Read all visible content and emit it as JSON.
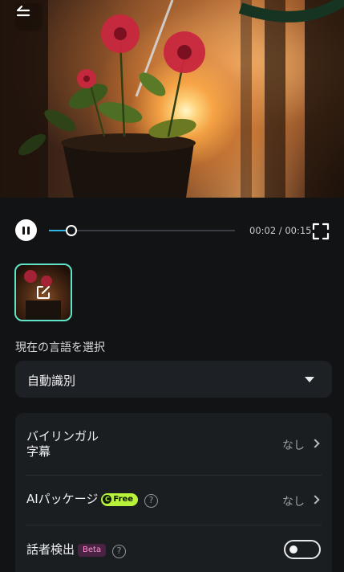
{
  "player": {
    "time_display": "00:02 / 00:15",
    "progress_fraction": 0.12
  },
  "language": {
    "label": "現在の言語を選択",
    "selected": "自動識別"
  },
  "settings": {
    "bilingual": {
      "title": "バイリンガル\n字幕",
      "value": "なし"
    },
    "ai_package": {
      "title": "AIパッケージ",
      "badge": "Free",
      "badge_coin": "C",
      "value": "なし",
      "help": "?"
    },
    "speaker": {
      "title": "話者検出",
      "badge": "Beta",
      "help": "?",
      "enabled": false
    }
  },
  "colors": {
    "accent_teal": "#5fe3c9",
    "progress_blue": "#31b4e6",
    "free_badge": "#b8f23a",
    "beta_badge_text": "#ff8fd6"
  },
  "icons": [
    "back-arrow-icon",
    "pause-icon",
    "fullscreen-icon",
    "edit-icon",
    "caret-down-icon",
    "chevron-right-icon",
    "help-icon"
  ]
}
